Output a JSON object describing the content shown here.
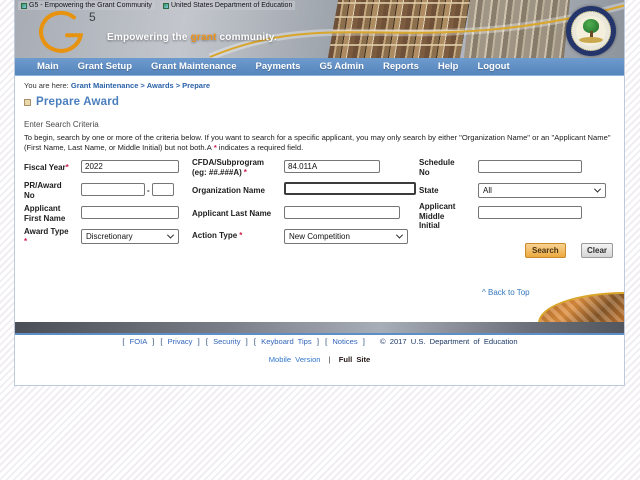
{
  "window_titles": {
    "g5": "G5 - Empowering the Grant Community",
    "ed": "United States Department of Education"
  },
  "header": {
    "logo_number": "5",
    "tagline_pre": "Empowering the ",
    "tagline_highlight": "grant",
    "tagline_post": " community."
  },
  "nav": {
    "items": [
      "Main",
      "Grant Setup",
      "Grant Maintenance",
      "Payments",
      "G5 Admin",
      "Reports",
      "Help",
      "Logout"
    ]
  },
  "breadcrumb": {
    "prefix": "You are here:",
    "separator": ">",
    "links": [
      "Grant Maintenance",
      "Awards",
      "Prepare"
    ]
  },
  "page": {
    "title": "Prepare Award",
    "section_heading": "Enter Search Criteria",
    "instructions_part1": "To begin, search by one or more of the criteria below. If you want to search for a specific applicant, you may only search by either \"Organization Name\" or an \"Applicant Name\" (First Name, Last Name, or Middle Initial) but not both.A",
    "required_marker": "*",
    "instructions_part2": "indicates a required field."
  },
  "form": {
    "fiscal_year": {
      "label": "Fiscal Year",
      "marker": "*",
      "value": "2022"
    },
    "cfda": {
      "label_line1": "CFDA/Subprogram",
      "label_line2": "(eg: ##.###A)",
      "marker": "*",
      "value": "84.011A"
    },
    "schedule_no": {
      "label": "Schedule No",
      "value": ""
    },
    "pr_award_no": {
      "label": "PR/Award No",
      "separator": "-",
      "value1": "",
      "value2": ""
    },
    "organization_name": {
      "label": "Organization Name",
      "value": ""
    },
    "state": {
      "label": "State",
      "value": "All"
    },
    "applicant_first_name": {
      "label": "Applicant First Name",
      "value": ""
    },
    "applicant_last_name": {
      "label": "Applicant Last Name",
      "value": ""
    },
    "applicant_middle_initial": {
      "label": "Applicant Middle Initial",
      "value": ""
    },
    "award_type": {
      "label": "Award Type",
      "marker": "*",
      "value": "Discretionary"
    },
    "action_type": {
      "label": "Action Type",
      "marker": "*",
      "value": "New Competition"
    },
    "search_button": "Search",
    "clear_button": "Clear"
  },
  "back_to_top": "^ Back to Top",
  "footer": {
    "bracket_open": "[",
    "bracket_close": "]",
    "links": [
      "FOIA",
      "Privacy",
      "Security",
      "Keyboard Tips",
      "Notices"
    ],
    "copyright": "© 2017 U.S. Department of Education",
    "mobile_version": "Mobile Version",
    "divider": "|",
    "full_site": "Full Site"
  },
  "colors": {
    "nav_blue": "#5d8ec6",
    "title_blue": "#4a7ebd",
    "accent_orange": "#e8930f",
    "required_red": "#d02050",
    "search_button_orange": "#eca93e",
    "link_blue": "#3366bb"
  }
}
